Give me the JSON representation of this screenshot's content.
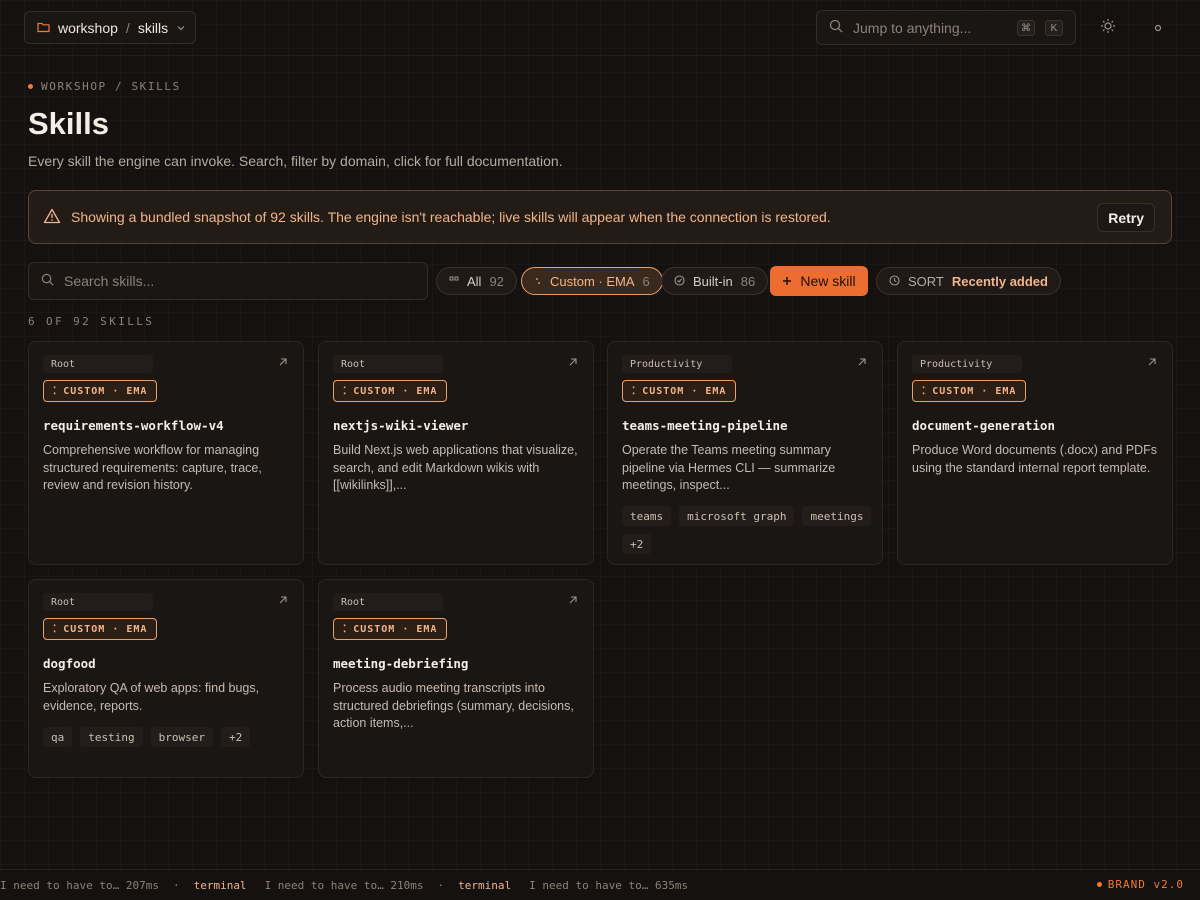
{
  "workspace": {
    "name": "workshop",
    "separator": "/",
    "section": "skills"
  },
  "command": {
    "placeholder": "Jump to anything...",
    "key_mod": "⌘",
    "key": "K"
  },
  "breadcrumb": "WORKSHOP / SKILLS",
  "page": {
    "title": "Skills",
    "subtitle": "Every skill the engine can invoke. Search, filter by domain, click for full documentation."
  },
  "banner": {
    "message": "Showing a bundled snapshot of 92 skills. The engine isn't reachable; live skills will appear when the connection is restored.",
    "action": "Retry"
  },
  "search": {
    "placeholder": "Search skills..."
  },
  "filters": [
    {
      "label": "All",
      "count": "92",
      "active": false
    },
    {
      "label": "Custom · EMA",
      "count": "6",
      "active": true
    },
    {
      "label": "Built-in",
      "count": "86",
      "active": false
    }
  ],
  "new_skill_label": "New skill",
  "sort": {
    "label": "SORT",
    "value": "Recently added"
  },
  "result_count": "6 OF 92 SKILLS",
  "badge_label": "CUSTOM · EMA",
  "skills": [
    {
      "domain": "Root",
      "name": "requirements-workflow-v4",
      "description": "Comprehensive workflow for managing structured requirements: capture, trace, review and revision history.",
      "tags": []
    },
    {
      "domain": "Root",
      "name": "nextjs-wiki-viewer",
      "description": "Build Next.js web applications that visualize, search, and edit Markdown wikis with [[wikilinks]],...",
      "tags": []
    },
    {
      "domain": "Productivity",
      "name": "teams-meeting-pipeline",
      "description": "Operate the Teams meeting summary pipeline via Hermes CLI — summarize meetings, inspect...",
      "tags": [
        "teams",
        "microsoft graph",
        "meetings",
        "+2"
      ]
    },
    {
      "domain": "Productivity",
      "name": "document-generation",
      "description": "Produce Word documents (.docx) and PDFs using the standard internal report template.",
      "tags": []
    },
    {
      "domain": "Root",
      "name": "dogfood",
      "description": "Exploratory QA of web apps: find bugs, evidence, reports.",
      "tags": [
        "qa",
        "testing",
        "browser",
        "+2"
      ]
    },
    {
      "domain": "Root",
      "name": "meeting-debriefing",
      "description": "Process audio meeting transcripts into structured debriefings (summary, decisions, action items,...",
      "tags": []
    }
  ],
  "footer": {
    "entries": [
      {
        "text": "I need to have to… 207ms"
      },
      {
        "label": "terminal",
        "text": "I need to have to… 210ms"
      },
      {
        "label": "terminal",
        "text": "I need to have to… 635ms"
      }
    ],
    "separator": "·",
    "brand": "BRAND v2.0"
  },
  "colors": {
    "accent": "#ec6d2f",
    "accent_text": "#f2b48a",
    "background": "#141110",
    "card": "#1a1614"
  }
}
